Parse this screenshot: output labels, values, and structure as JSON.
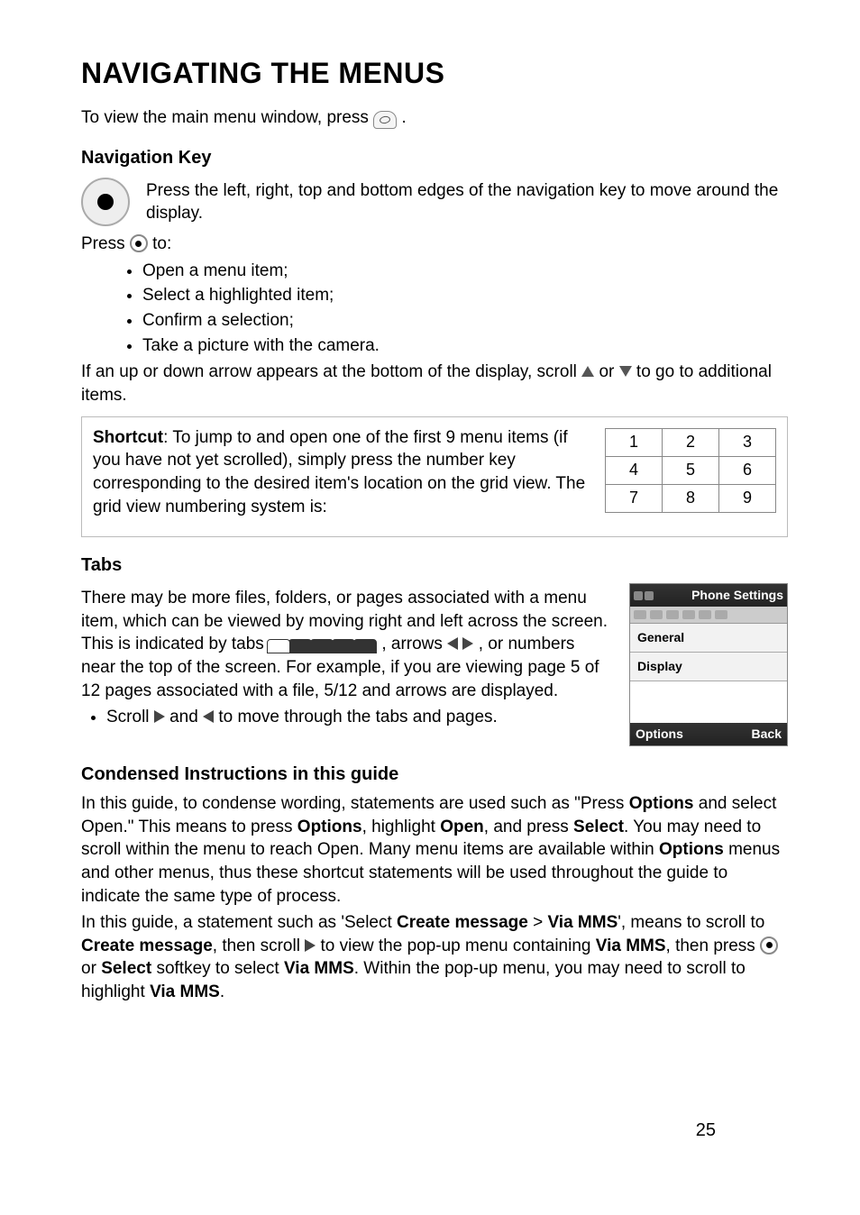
{
  "title": "NAVIGATING THE MENUS",
  "intro_a": "To view the main menu window, press ",
  "intro_b": " .",
  "section_nav_key": "Navigation Key",
  "nav_key_para": "Press the left, right, top and bottom edges of the navigation key to move around the display.",
  "press_to_a": "Press ",
  "press_to_b": " to:",
  "press_items": [
    "Open a menu item;",
    "Select a highlighted item;",
    "Confirm a selection;",
    "Take a picture with the camera."
  ],
  "arrows_a": "If an up or down arrow appears at the bottom of the display, scroll ",
  "arrows_b": " or ",
  "arrows_c": " to go to additional items.",
  "shortcut_label": "Shortcut",
  "shortcut_text": ": To jump to and open one of the first 9 menu items (if you have not yet scrolled), simply press the number key corresponding to the desired item's location on the grid view. The grid view numbering system is:",
  "grid": [
    [
      "1",
      "2",
      "3"
    ],
    [
      "4",
      "5",
      "6"
    ],
    [
      "7",
      "8",
      "9"
    ]
  ],
  "section_tabs": "Tabs",
  "tabs_a": "There may be more files, folders, or pages associated with a menu item, which can be viewed by moving right and left across the screen. This is indicated by tabs ",
  "tabs_b": " , arrows ",
  "tabs_c": ", or numbers near the top of the screen.  For example, if you are viewing page 5 of 12 pages associated with a file, 5/12 and arrows are displayed.",
  "tabs_scroll_a": "Scroll ",
  "tabs_scroll_b": " and ",
  "tabs_scroll_c": " to move through the tabs and pages.",
  "phone": {
    "title": "Phone Settings",
    "item1": "General",
    "item2": "Display",
    "options": "Options",
    "back": "Back"
  },
  "section_condensed": "Condensed Instructions in this guide",
  "cond_p1_a": "In this guide, to condense wording, statements are used such as \"Press ",
  "cond_p1_b": " and select Open.\" This means to press ",
  "cond_p1_c": ", highlight ",
  "cond_p1_d": ", and press ",
  "cond_p1_e": ". You may need to scroll within the menu to reach Open. Many menu items are available within ",
  "cond_p1_f": " menus and other menus, thus these shortcut statements will be used throughout the guide to indicate the same type of process.",
  "cond_p2_a": "In this guide, a statement such as 'Select ",
  "cond_p2_b": " > ",
  "cond_p2_c": "', means to scroll to ",
  "cond_p2_d": ", then scroll ",
  "cond_p2_e": " to view the pop-up menu containing ",
  "cond_p2_f": ", then press ",
  "cond_p2_g": " or ",
  "cond_p2_h": " softkey to select ",
  "cond_p2_i": ". Within the pop-up menu, you may need to scroll to highlight ",
  "cond_p2_j": ".",
  "bold": {
    "options": "Options",
    "open": "Open",
    "select": "Select",
    "create_message": "Create message",
    "via_mms": "Via MMS"
  },
  "page_number": "25"
}
